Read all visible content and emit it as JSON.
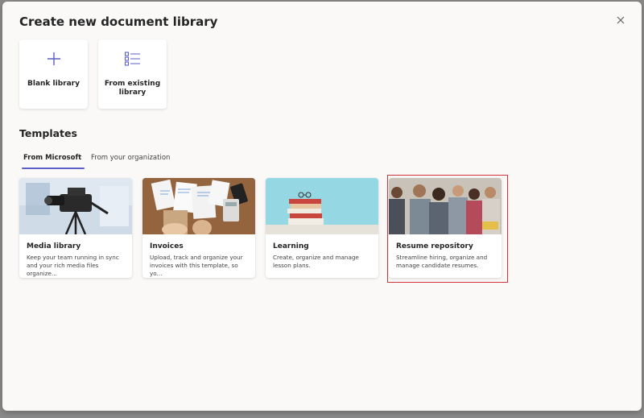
{
  "dialog": {
    "title": "Create new document library",
    "close_icon": "close-icon"
  },
  "start_options": [
    {
      "label": "Blank library",
      "icon": "plus-icon"
    },
    {
      "label": "From existing library",
      "icon": "list-icon"
    }
  ],
  "templates": {
    "heading": "Templates",
    "tabs": [
      {
        "label": "From Microsoft",
        "active": true
      },
      {
        "label": "From your organization",
        "active": false
      }
    ],
    "items": [
      {
        "name": "Media library",
        "description": "Keep your team running in sync and your rich media files organize...",
        "image": "video-camera-photo"
      },
      {
        "name": "Invoices",
        "description": "Upload, track and organize your invoices with this template, so yo...",
        "image": "invoices-desk-photo"
      },
      {
        "name": "Learning",
        "description": "Create, organize and manage lesson plans.",
        "image": "books-stack-photo"
      },
      {
        "name": "Resume repository",
        "description": "Streamline hiring, organize and manage candidate resumes.",
        "image": "candidates-waiting-photo",
        "highlighted": true
      }
    ]
  },
  "colors": {
    "accent": "#5b5fc7",
    "highlight_border": "#d13438",
    "dialog_bg": "#faf9f8"
  }
}
